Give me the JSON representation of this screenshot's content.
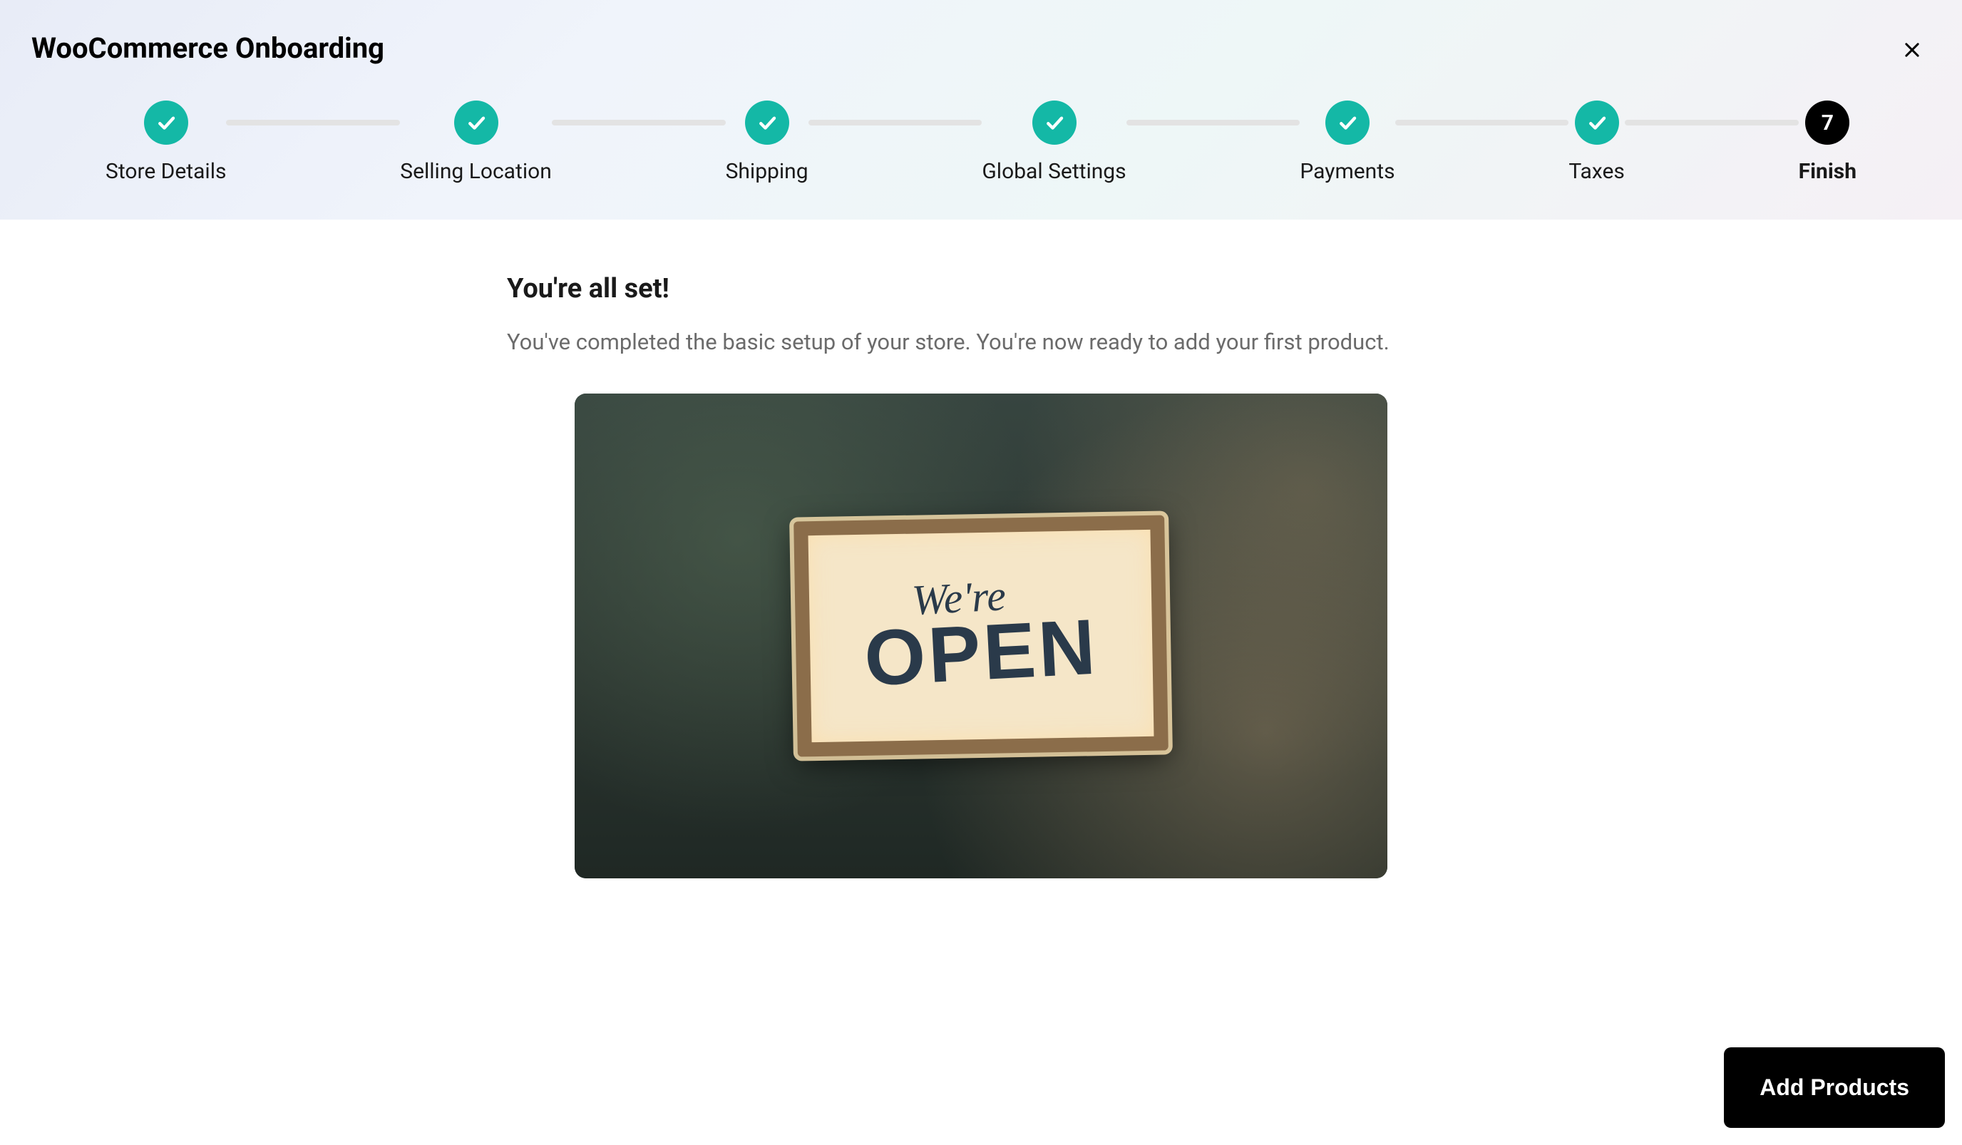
{
  "header": {
    "title": "WooCommerce Onboarding"
  },
  "stepper": {
    "steps": [
      {
        "label": "Store Details",
        "state": "done"
      },
      {
        "label": "Selling Location",
        "state": "done"
      },
      {
        "label": "Shipping",
        "state": "done"
      },
      {
        "label": "Global Settings",
        "state": "done"
      },
      {
        "label": "Payments",
        "state": "done"
      },
      {
        "label": "Taxes",
        "state": "done"
      },
      {
        "label": "Finish",
        "state": "current",
        "number": "7"
      }
    ]
  },
  "content": {
    "heading": "You're all set!",
    "description": "You've completed the basic setup of your store. You're now ready to add your first product.",
    "hero_sign_line1": "We're",
    "hero_sign_line2": "OPEN"
  },
  "footer": {
    "add_products_label": "Add Products"
  },
  "colors": {
    "accent_done": "#14b8a6",
    "accent_current": "#000000"
  }
}
